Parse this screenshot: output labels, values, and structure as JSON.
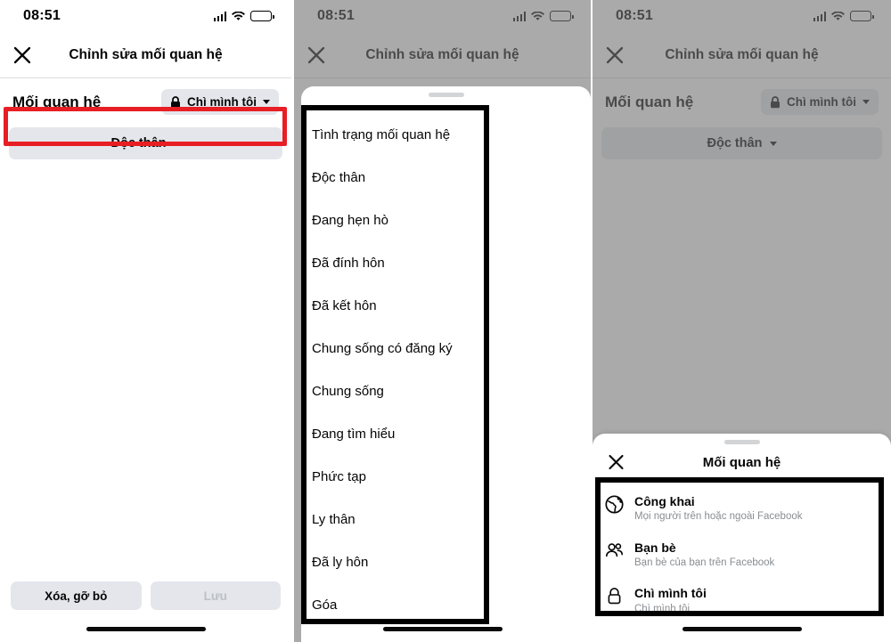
{
  "status_bar": {
    "time": "08:51",
    "signal_icon": "cellular-signal-icon",
    "wifi_icon": "wifi-icon",
    "battery_icon": "battery-icon"
  },
  "nav": {
    "title": "Chỉnh sửa mối quan hệ",
    "close_icon": "close-icon"
  },
  "editor": {
    "section_label": "Mối quan hệ",
    "privacy_chip": {
      "label": "Chì mình tôi",
      "lock_icon": "lock-icon",
      "caret_icon": "chevron-down-icon"
    },
    "status_button": {
      "label": "Độc thân",
      "caret_icon": "chevron-down-icon"
    },
    "delete_button": "Xóa, gỡ bỏ",
    "save_button": "Lưu"
  },
  "status_sheet": {
    "grabber": "drag-handle",
    "options": [
      "Tình trạng mối quan hệ",
      "Độc thân",
      "Đang hẹn hò",
      "Đã đính hôn",
      "Đã kết hôn",
      "Chung sống có đăng ký",
      "Chung sống",
      "Đang tìm hiểu",
      "Phức tạp",
      "Ly thân",
      "Đã ly hôn",
      "Góa"
    ]
  },
  "privacy_sheet": {
    "title": "Mối quan hệ",
    "close_icon": "close-icon",
    "grabber": "drag-handle",
    "options": [
      {
        "icon": "globe-icon",
        "title": "Công khai",
        "subtitle": "Mọi người trên hoặc ngoài Facebook"
      },
      {
        "icon": "friends-icon",
        "title": "Bạn bè",
        "subtitle": "Bạn bè của bạn trên Facebook"
      },
      {
        "icon": "lock-icon",
        "title": "Chì mình tôi",
        "subtitle": "Chì mình tôi"
      }
    ]
  },
  "annotations": {
    "highlight_color": "#e81e25",
    "box_color": "#000000"
  }
}
